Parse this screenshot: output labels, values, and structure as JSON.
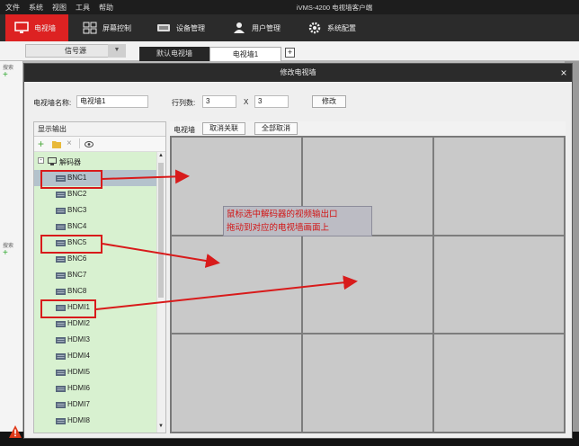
{
  "menu": {
    "items": [
      "文件",
      "系统",
      "视图",
      "工具",
      "帮助"
    ],
    "app_title": "iVMS-4200 电视墙客户端"
  },
  "toolbar": {
    "items": [
      {
        "label": "电视墙",
        "icon": "monitor-icon",
        "active": true
      },
      {
        "label": "屏幕控制",
        "icon": "grid-icon",
        "active": false
      },
      {
        "label": "设备管理",
        "icon": "device-icon",
        "active": false
      },
      {
        "label": "用户管理",
        "icon": "user-icon",
        "active": false
      },
      {
        "label": "系统配置",
        "icon": "gear-icon",
        "active": false
      }
    ],
    "active_color": "#dd2222"
  },
  "subbar": {
    "signal_source": "信号源",
    "tabs": [
      "默认电视墙",
      "电视墙1"
    ],
    "add_tab": "+"
  },
  "sidebar": {
    "search_label": "搜索"
  },
  "dialog": {
    "title": "修改电视墙",
    "close": "×",
    "name_label": "电视墙名称:",
    "name_value": "电视墙1",
    "rowcol_label": "行列数:",
    "rows": "3",
    "x": "X",
    "cols": "3",
    "modify_button": "修改",
    "output_panel_title": "显示输出",
    "tree": {
      "root": "解码器",
      "outputs": [
        "BNC1",
        "BNC2",
        "BNC3",
        "BNC4",
        "BNC5",
        "BNC6",
        "BNC7",
        "BNC8",
        "HDMI1",
        "HDMI2",
        "HDMI3",
        "HDMI4",
        "HDMI5",
        "HDMI6",
        "HDMI7",
        "HDMI8"
      ],
      "selected": "BNC1",
      "highlighted": [
        "BNC1",
        "BNC5",
        "HDMI1"
      ]
    },
    "wall_tabs": {
      "label": "电视墙",
      "unlink": "取消关联",
      "unlink_all": "全部取消"
    },
    "grid": {
      "rows": 3,
      "cols": 3
    }
  },
  "annotation": {
    "line1": "鼠标选中解码器的视频输出口",
    "line2": "拖动到对应的电视墙画面上",
    "color": "#d21414"
  }
}
